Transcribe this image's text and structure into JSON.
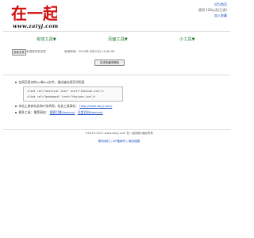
{
  "header": {
    "logo_text": "在一起",
    "site_url": "www.zaiyj.com",
    "top_links": {
      "line1": "设为首页",
      "line2": "便用 126以及(已读)",
      "line3": "加入收藏"
    }
  },
  "menu": [
    {
      "label": "有效工具▼"
    },
    {
      "label": "页面工具▼"
    },
    {
      "label": "小工具▼"
    }
  ],
  "toolbar": {
    "choose_file_label": "选择文件",
    "no_file_text": "未选择任何文件",
    "time_label": "系统时间：",
    "time_value": "2019年 8月22日 11:40:49",
    "generate_label": "生成收藏夹图标"
  },
  "content": {
    "bullet1": "在网页里内的ico和ico文件，请应放在网页代码里",
    "code_line1": "<link rel=\"shortcut icon\" href=\"favicon.ico\"/>",
    "code_line2": "<link rel=\"bookmark\" href=\"favicon.ico\"/>",
    "bullet2": "本站工具有站长和IT技术网，站长工具网址：",
    "bullet2_link": "http://www.zaiyj.com/",
    "bullet3": "更多工具：推荐网站：",
    "bullet3_link1": "搜索引擎(favicon)",
    "bullet3_link2": "百度百科(favicon)"
  },
  "footer": {
    "copyright": "©2019-2021 www.zaiyj.com 在一起网络 版权所有",
    "links": "联系我们 | ICP备案号 | 网站地图"
  }
}
